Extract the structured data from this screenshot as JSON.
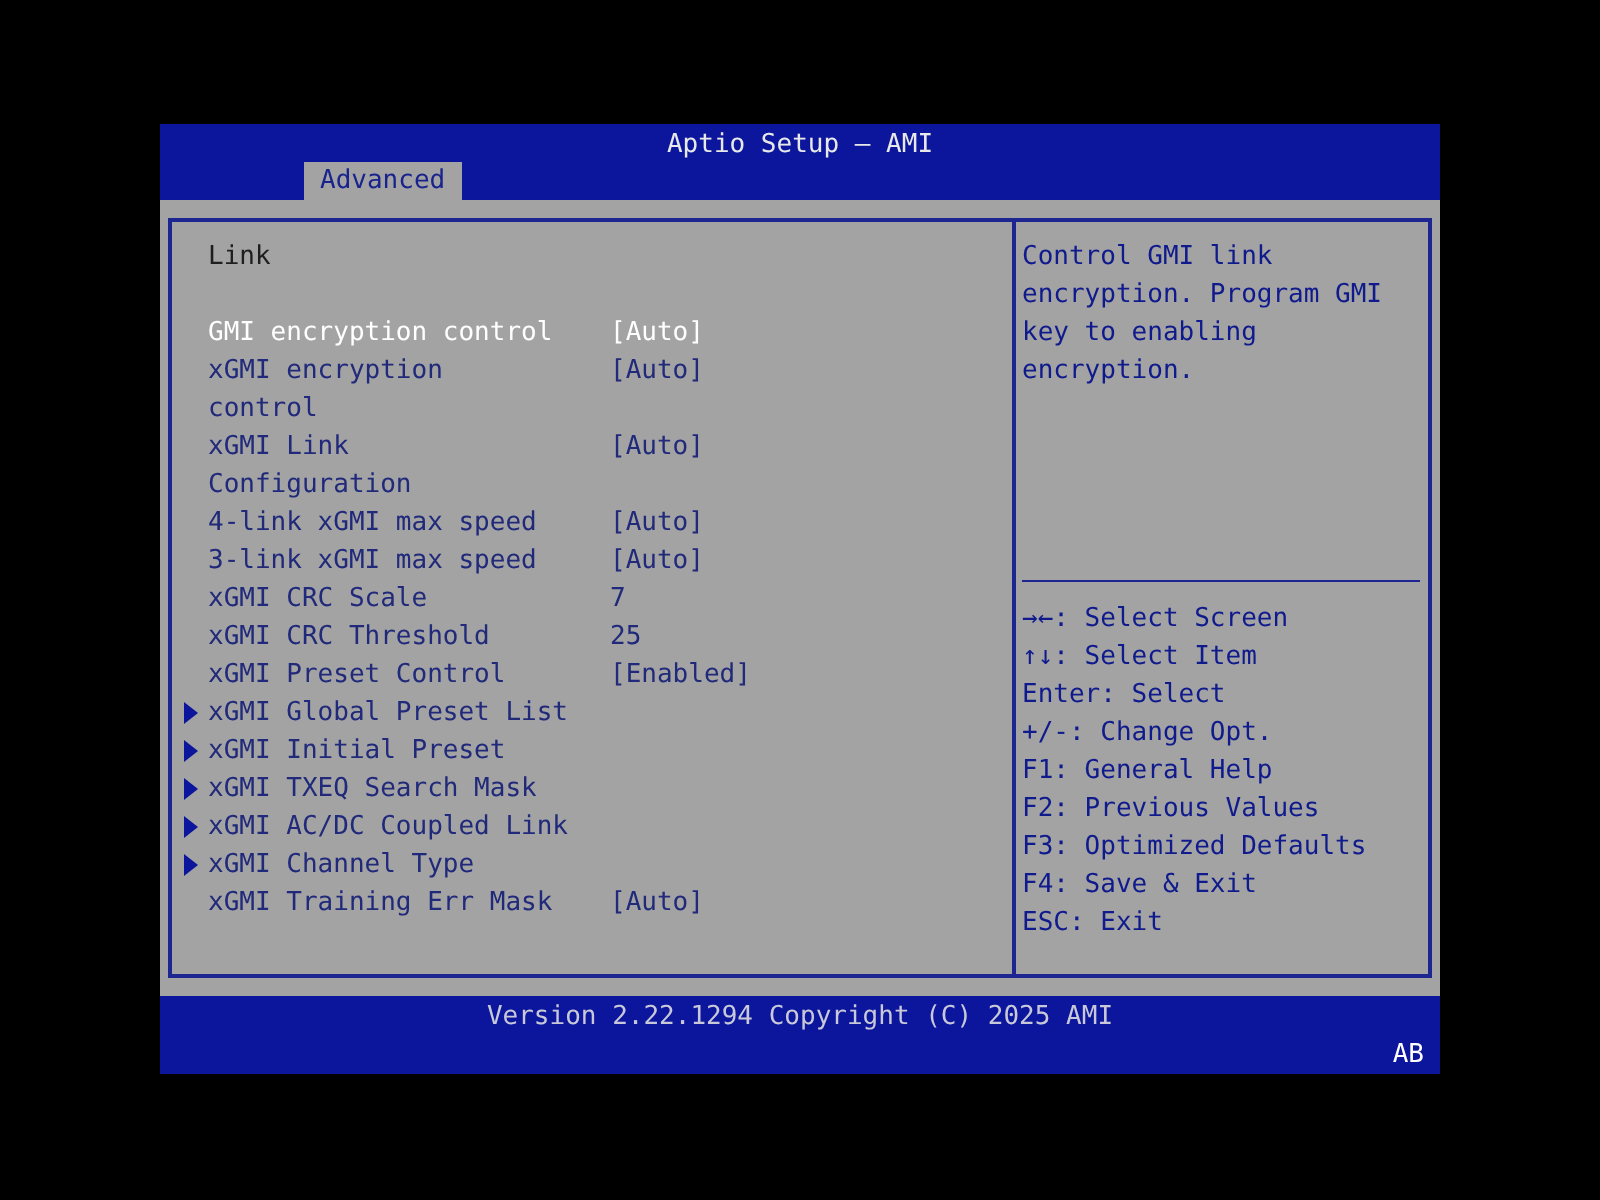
{
  "window": {
    "title": "Aptio Setup – AMI"
  },
  "tabs": [
    {
      "label": "Advanced",
      "selected": true
    }
  ],
  "section_title": "Link",
  "items": [
    {
      "kind": "setting",
      "label": "GMI encryption control",
      "value": "[Auto]",
      "selected": true
    },
    {
      "kind": "setting",
      "label": "xGMI encryption control",
      "value": "[Auto]",
      "selected": false
    },
    {
      "kind": "setting",
      "label": "xGMI Link Configuration",
      "value": "[Auto]",
      "selected": false
    },
    {
      "kind": "setting",
      "label": "4-link xGMI max speed",
      "value": "[Auto]",
      "selected": false
    },
    {
      "kind": "setting",
      "label": "3-link xGMI max speed",
      "value": "[Auto]",
      "selected": false
    },
    {
      "kind": "setting",
      "label": "xGMI CRC Scale",
      "value": "7",
      "selected": false
    },
    {
      "kind": "setting",
      "label": "xGMI CRC Threshold",
      "value": "25",
      "selected": false
    },
    {
      "kind": "setting",
      "label": "xGMI Preset Control",
      "value": "[Enabled]",
      "selected": false
    },
    {
      "kind": "submenu",
      "label": "xGMI Global Preset List",
      "selected": false
    },
    {
      "kind": "submenu",
      "label": "xGMI Initial Preset",
      "selected": false
    },
    {
      "kind": "submenu",
      "label": "xGMI TXEQ Search Mask",
      "selected": false
    },
    {
      "kind": "submenu",
      "label": "xGMI AC/DC Coupled Link",
      "selected": false
    },
    {
      "kind": "submenu",
      "label": "xGMI Channel Type",
      "selected": false
    },
    {
      "kind": "setting",
      "label": "xGMI Training Err Mask",
      "value": "[Auto]",
      "selected": false
    }
  ],
  "help": {
    "text": "Control GMI link encryption. Program GMI key to enabling encryption.",
    "keys": [
      "→←: Select Screen",
      "↑↓: Select Item",
      "Enter: Select",
      "+/-: Change Opt.",
      "F1: General Help",
      "F2: Previous Values",
      "F3: Optimized Defaults",
      "F4: Save & Exit",
      "ESC: Exit"
    ]
  },
  "status_bar": {
    "version": "Version 2.22.1294 Copyright (C) 2025 AMI",
    "indicator": "AB"
  }
}
